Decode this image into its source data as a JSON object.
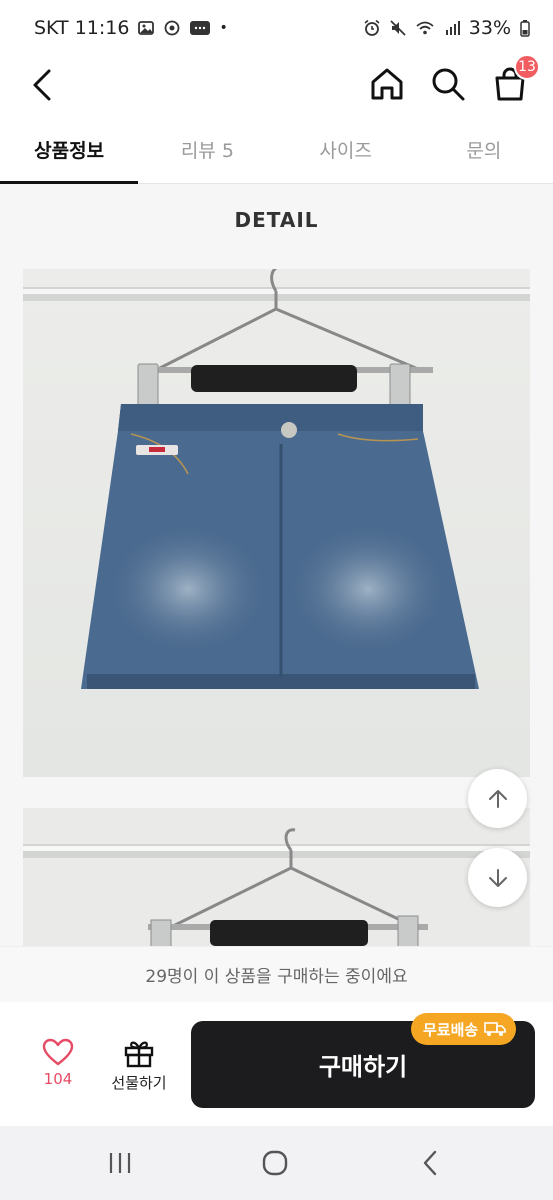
{
  "status_bar": {
    "carrier_time": "SKT 11:16",
    "dot": "•",
    "battery": "33%"
  },
  "header": {
    "icons": [
      "back-icon",
      "home-icon",
      "search-icon",
      "shopping-bag-icon"
    ],
    "cart_count": "13"
  },
  "tabs": [
    {
      "label": "상품정보",
      "active": true
    },
    {
      "label": "리뷰 5",
      "active": false
    },
    {
      "label": "사이즈",
      "active": false
    },
    {
      "label": "문의",
      "active": false
    }
  ],
  "detail": {
    "title": "DETAIL"
  },
  "notice": {
    "text": "29명이 이 상품을 구매하는 중이에요"
  },
  "bottom_bar": {
    "like_count": "104",
    "gift_label": "선물하기",
    "buy_label": "구매하기",
    "shipping_badge": "무료배송"
  },
  "colors": {
    "accent": "#e54b64",
    "badge": "#f15d60",
    "shipping": "#f5a623",
    "buy_button": "#1c1c1e"
  }
}
